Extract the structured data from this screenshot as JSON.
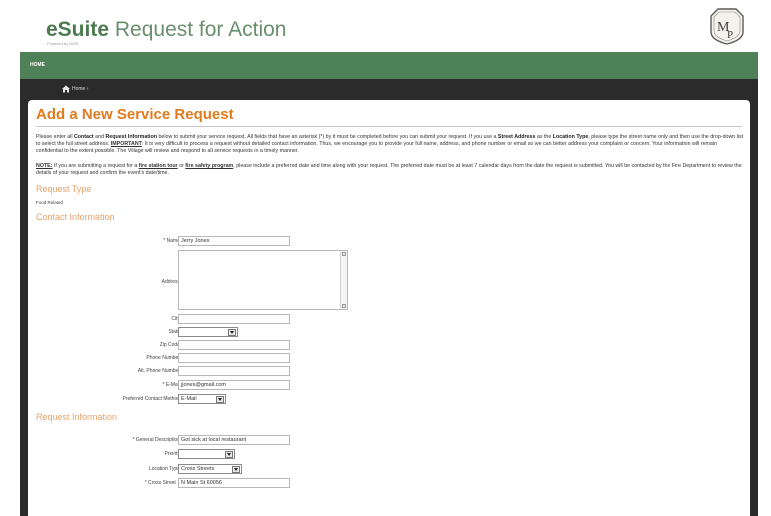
{
  "brand": {
    "strong": "eSuite",
    "rest": " Request for Action",
    "powered_by": "Powered by NWS",
    "seal_letters": "MP"
  },
  "nav": {
    "home_tab": "HOME"
  },
  "breadcrumb": {
    "home": "Home ›"
  },
  "page": {
    "title": "Add a New Service Request",
    "intro": {
      "p1": "Please enter all ",
      "contact": "Contact",
      "p2": " and ",
      "request_info": "Request Information",
      "p3": " below to submit your service request. All fields that have an asterisk (*) by it must be completed before you can submit your request. If you use a ",
      "street_address": "Street Address",
      "p4": " as the ",
      "location_type": "Location Type",
      "p5": ", please type the street name only and then use the drop-down list to select the full street address. ",
      "important": "IMPORTANT",
      "p6": ": It is very difficult to process a request without detailed contact information. Thus, we encourage you to provide your full name, address, and phone number or email so we can better address your complaint or concern. Your information will remain confidential to the extent possible. The Village will review and respond to all service requests in a timely manner."
    },
    "note": {
      "label": "NOTE:",
      "p1": " If you are submitting a request for a ",
      "tour": "fire station tour",
      "p2": " or ",
      "program": "fire safety program",
      "p3": ", please include a preferred date and time along with your request. The preferred date must be at least 7 calendar days from the date the request is submitted. You will be contacted by the Fire Department to review the details of your request and confirm the event's date/time."
    }
  },
  "request_type": {
    "heading": "Request Type",
    "value": "Food Related"
  },
  "contact": {
    "heading": "Contact Information",
    "name_label": "* Name",
    "name_value": "Jerry Jones",
    "address_label": "Address",
    "city_label": "City",
    "state_label": "State",
    "state_value": "",
    "zip_label": "Zip Code",
    "phone_label": "Phone Number",
    "alt_phone_label": "Alt. Phone Number",
    "email_label": "* E-Mail",
    "email_value": "jjones@gmail.com",
    "pref_label": "Preferred Contact Method",
    "pref_value": "E-Mail"
  },
  "request_info": {
    "heading": "Request Information",
    "desc_label": "* General Description",
    "desc_value": "Got sick at local restaurant",
    "priority_label": "Priority",
    "priority_value": "",
    "loc_type_label": "Location Type",
    "loc_type_value": "Cross Streets",
    "cross1_label": "* Cross Street 1",
    "cross1_value": "N Main St 60056"
  },
  "colors": {
    "accent_orange": "#e07b1f",
    "section_orange": "#e8a26a",
    "brand_green": "#4f8159",
    "frame_dark": "#2b2b2b"
  }
}
